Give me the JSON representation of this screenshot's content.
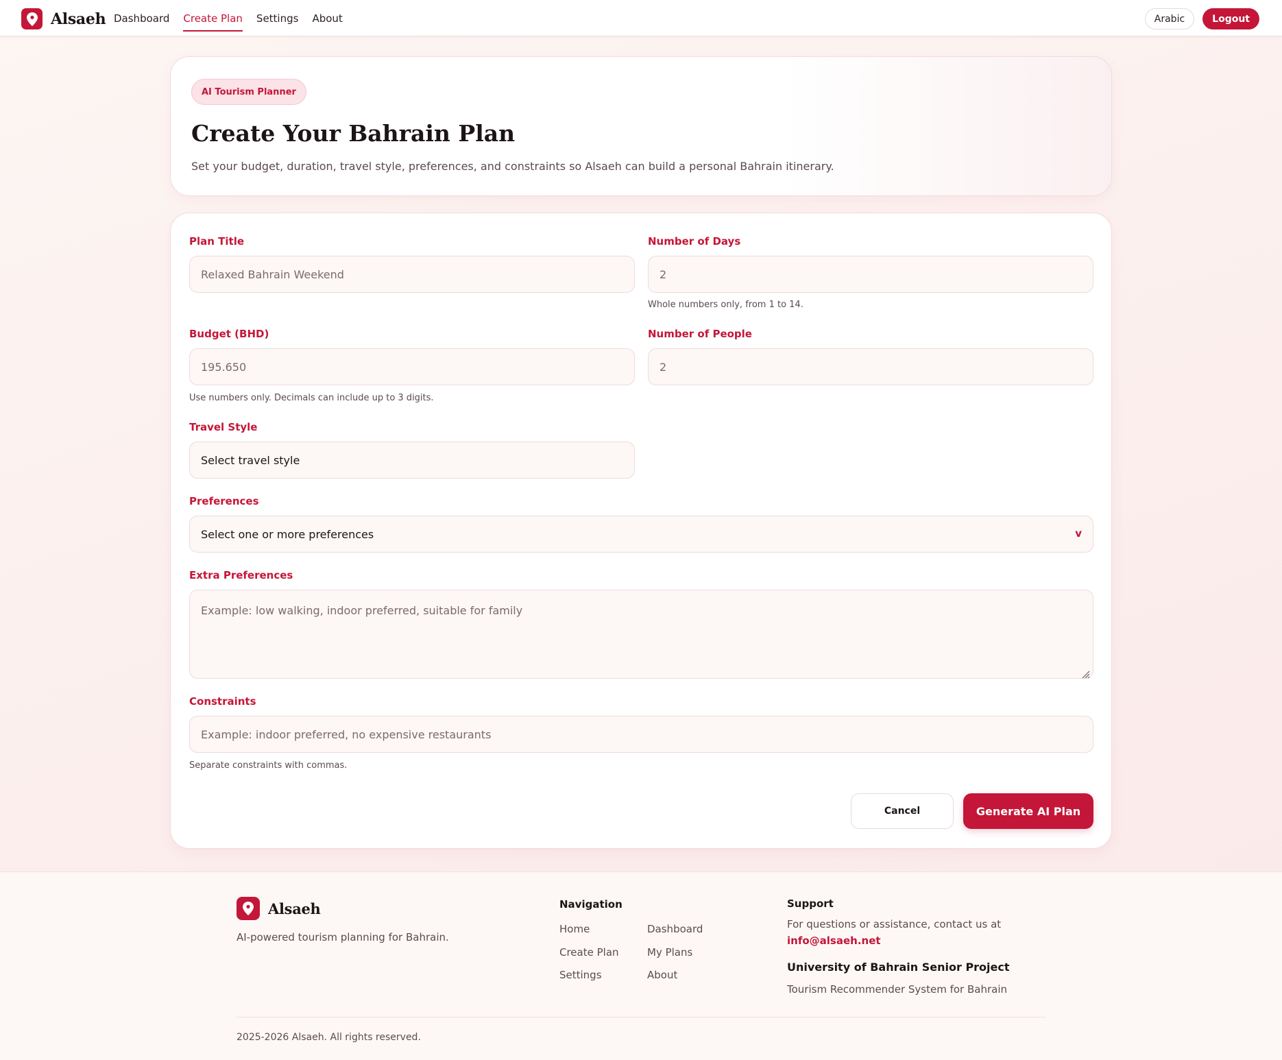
{
  "navbar": {
    "brand": "Alsaeh",
    "links": [
      "Dashboard",
      "Create Plan",
      "Settings",
      "About"
    ],
    "active": "Create Plan",
    "language_button": "Arabic",
    "logout_button": "Logout"
  },
  "hero": {
    "badge": "AI Tourism Planner",
    "title": "Create Your Bahrain Plan",
    "subtitle": "Set your budget, duration, travel style, preferences, and constraints so Alsaeh can build a personal Bahrain itinerary."
  },
  "form": {
    "plan_title": {
      "label": "Plan Title",
      "placeholder": "Relaxed Bahrain Weekend"
    },
    "days": {
      "label": "Number of Days",
      "placeholder": "2",
      "hint": "Whole numbers only, from 1 to 14."
    },
    "budget": {
      "label": "Budget (BHD)",
      "placeholder": "195.650",
      "hint": "Use numbers only. Decimals can include up to 3 digits."
    },
    "people": {
      "label": "Number of People",
      "placeholder": "2"
    },
    "travel_style": {
      "label": "Travel Style",
      "value": "Select travel style"
    },
    "preferences": {
      "label": "Preferences",
      "value": "Select one or more preferences",
      "chevron": "v"
    },
    "extra_preferences": {
      "label": "Extra Preferences",
      "placeholder": "Example: low walking, indoor preferred, suitable for family"
    },
    "constraints": {
      "label": "Constraints",
      "placeholder": "Example: indoor preferred, no expensive restaurants",
      "hint": "Separate constraints with commas."
    },
    "cancel_button": "Cancel",
    "generate_button": "Generate AI Plan"
  },
  "footer": {
    "brand": "Alsaeh",
    "tagline": "AI-powered tourism planning for Bahrain.",
    "nav_heading": "Navigation",
    "nav_col1": [
      "Home",
      "Create Plan",
      "Settings"
    ],
    "nav_col2": [
      "Dashboard",
      "My Plans",
      "About"
    ],
    "support_heading": "Support",
    "support_text": "For questions or assistance, contact us at",
    "support_email": "info@alsaeh.net",
    "project_title": "University of Bahrain Senior Project",
    "project_sub": "Tourism Recommender System for Bahrain",
    "copyright": "2025-2026 Alsaeh. All rights reserved."
  },
  "colors": {
    "accent": "#c41638",
    "accent_soft": "#fbe3e8",
    "field_bg": "#fdf7f5"
  },
  "icons": {
    "logo": "map-pin-icon",
    "resize": "resize-grip-icon"
  }
}
